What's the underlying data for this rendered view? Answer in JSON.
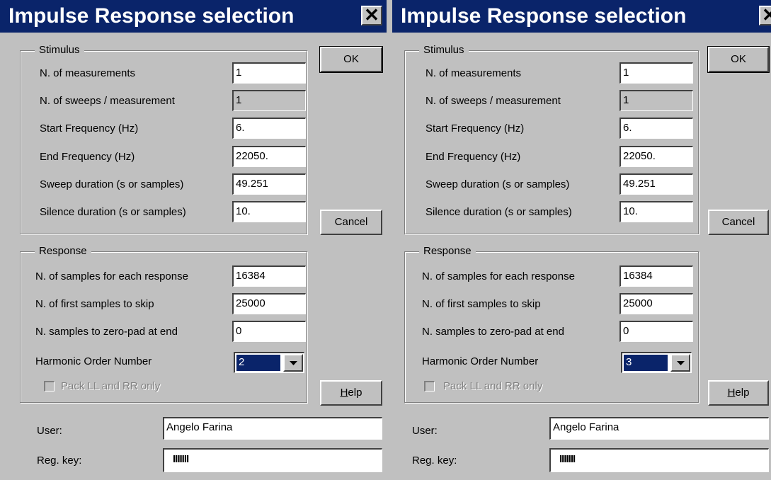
{
  "dialogs": [
    {
      "title": "Impulse Response selection",
      "close_glyph": "✕",
      "stimulus": {
        "legend": "Stimulus",
        "measurements_label": "N. of measurements",
        "measurements": "1",
        "sweeps_label": "N. of sweeps / measurement",
        "sweeps": "1",
        "start_freq_label": "Start Frequency (Hz)",
        "start_freq": "6.",
        "end_freq_label": "End Frequency (Hz)",
        "end_freq": "22050.",
        "sweep_dur_label": "Sweep duration (s or samples)",
        "sweep_dur": "49.251",
        "silence_dur_label": "Silence duration (s or samples)",
        "silence_dur": "10."
      },
      "response": {
        "legend": "Response",
        "samples_label": "N. of samples for each response",
        "samples": "16384",
        "skip_label": "N. of first samples to skip",
        "skip": "25000",
        "zeropad_label": "N. samples to zero-pad at end",
        "zeropad": "0",
        "harmonic_label": "Harmonic Order Number",
        "harmonic": "2",
        "pack_label": "Pack LL and RR only",
        "pack_checked": false
      },
      "ok_label": "OK",
      "cancel_label": "Cancel",
      "help_first": "H",
      "help_rest": "elp",
      "user_label": "User:",
      "user_value": "Angelo Farina",
      "regkey_label": "Reg. key:",
      "regkey_value": "IIIIIII"
    },
    {
      "title": "Impulse Response selection",
      "close_glyph": "✕",
      "stimulus": {
        "legend": "Stimulus",
        "measurements_label": "N. of measurements",
        "measurements": "1",
        "sweeps_label": "N. of sweeps / measurement",
        "sweeps": "1",
        "start_freq_label": "Start Frequency (Hz)",
        "start_freq": "6.",
        "end_freq_label": "End Frequency (Hz)",
        "end_freq": "22050.",
        "sweep_dur_label": "Sweep duration (s or samples)",
        "sweep_dur": "49.251",
        "silence_dur_label": "Silence duration (s or samples)",
        "silence_dur": "10."
      },
      "response": {
        "legend": "Response",
        "samples_label": "N. of samples for each response",
        "samples": "16384",
        "skip_label": "N. of first samples to skip",
        "skip": "25000",
        "zeropad_label": "N. samples to zero-pad at end",
        "zeropad": "0",
        "harmonic_label": "Harmonic Order Number",
        "harmonic": "3",
        "pack_label": "Pack LL and RR only",
        "pack_checked": false
      },
      "ok_label": "OK",
      "cancel_label": "Cancel",
      "help_first": "H",
      "help_rest": "elp",
      "user_label": "User:",
      "user_value": "Angelo Farina",
      "regkey_label": "Reg. key:",
      "regkey_value": "IIIIIII"
    }
  ],
  "colors": {
    "face": "#c0c0c0",
    "title_bar": "#0a246a",
    "selection": "#0a246a"
  }
}
